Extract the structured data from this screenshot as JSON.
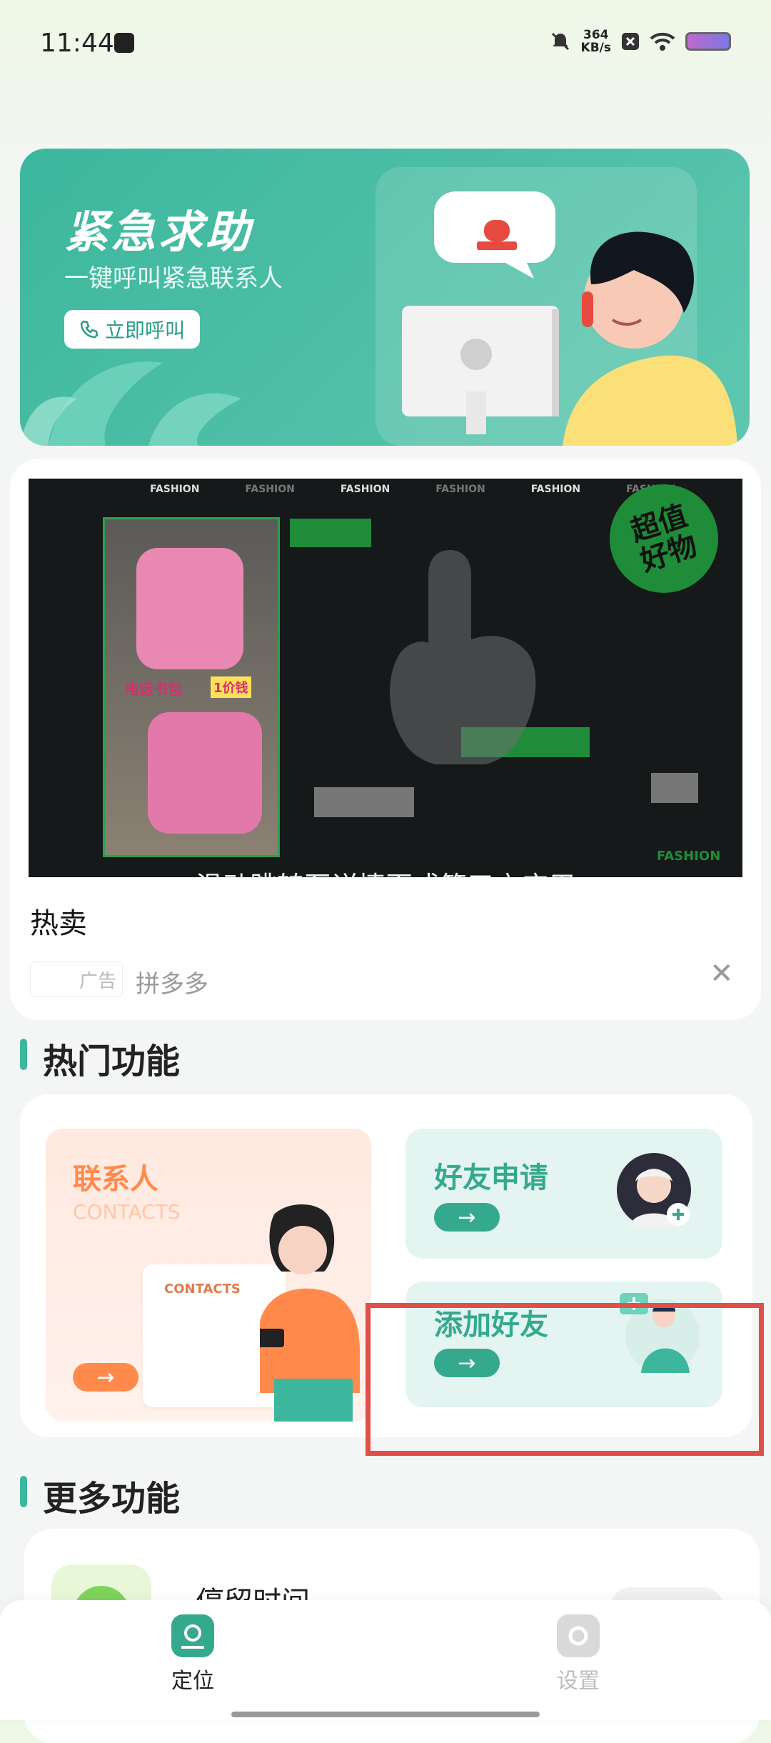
{
  "status_bar": {
    "time": "11:44",
    "speed_value": "364",
    "speed_unit": "KB/s",
    "icons": [
      "mute-bell-icon",
      "close-box-icon",
      "wifi-icon",
      "battery-icon"
    ]
  },
  "emergency": {
    "title": "紧急求助",
    "subtitle": "一键呼叫紧急联系人",
    "call_label": "立即呼叫",
    "accent": "#3cb79d"
  },
  "ad": {
    "top_banner_texts": [
      "FASHION",
      "FASHION",
      "FASHION",
      "FASHION",
      "FASHION",
      "FASHION"
    ],
    "badge_text": "超值好物",
    "product_text": "电话书包",
    "price_text": "1价钱",
    "corner_text": "FASHION",
    "caption": "滑动跳转至详情页或第三方应用",
    "title": "热卖",
    "label": "广告",
    "source": "拼多多"
  },
  "hot_section": {
    "title": "热门功能",
    "contacts": {
      "title": "联系人",
      "subtitle": "CONTACTS",
      "doc_label": "CONTACTS",
      "color": "#ff8a4c"
    },
    "friend_request": {
      "title": "好友申请",
      "color": "#35a98e"
    },
    "add_friend": {
      "title": "添加好友",
      "color": "#35a98e"
    }
  },
  "more_section": {
    "title": "更多功能",
    "first_item": "停留时间"
  },
  "bottom_nav": {
    "items": [
      {
        "label": "定位",
        "active": true,
        "color": "#35a98e"
      },
      {
        "label": "设置",
        "active": false,
        "color": "#c4c4c4"
      }
    ]
  }
}
